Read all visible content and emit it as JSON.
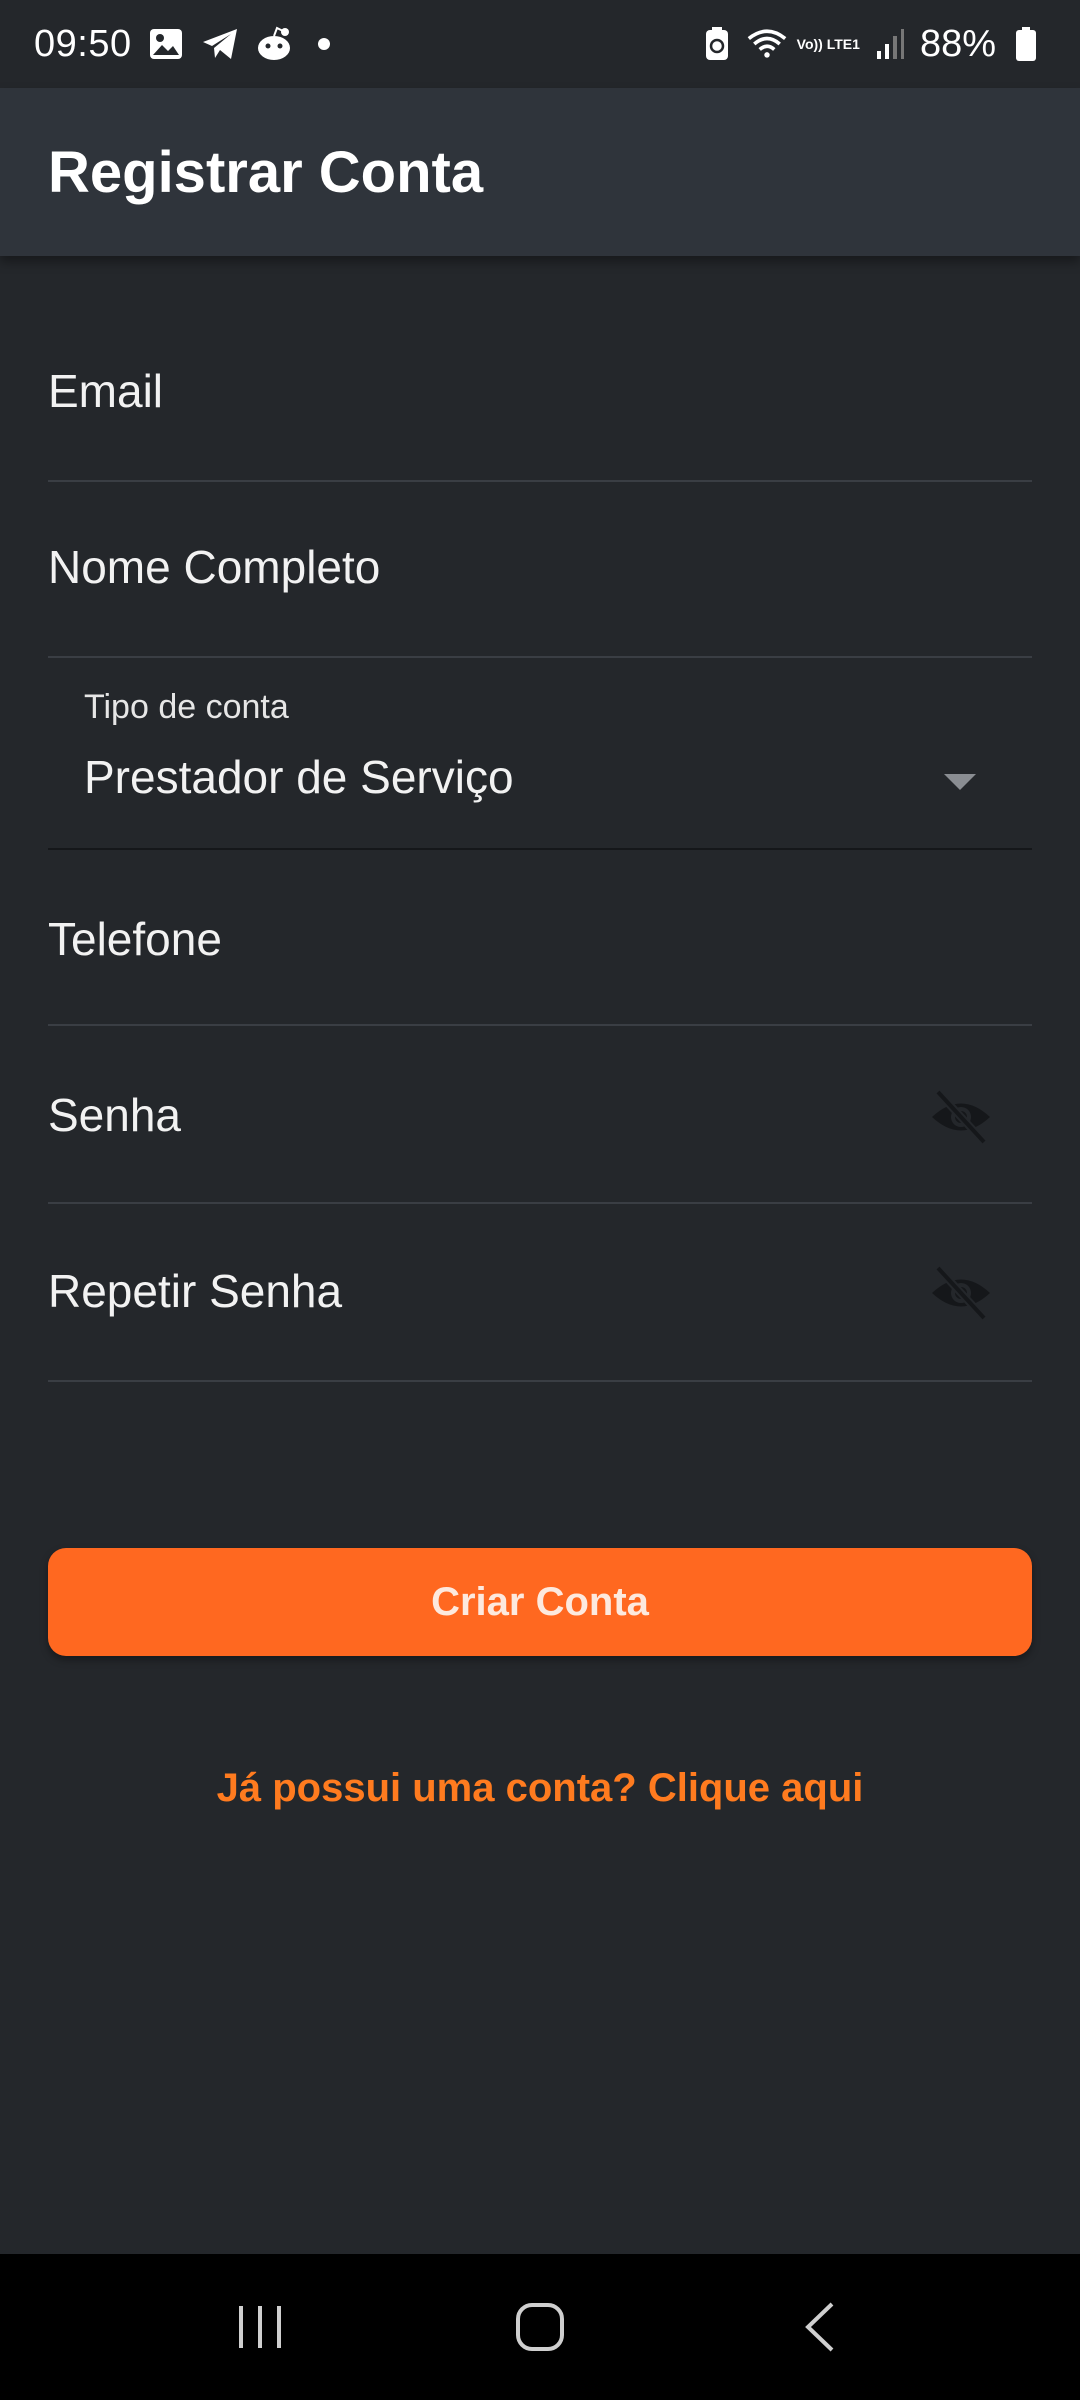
{
  "status_bar": {
    "time": "09:50",
    "battery_percent": "88%",
    "network_label": "Vo)) LTE1",
    "icons": [
      "gallery-icon",
      "telegram-icon",
      "reddit-icon",
      "notification-dot-icon",
      "battery-saver-icon",
      "wifi-icon",
      "volte-icon",
      "signal-icon",
      "battery-icon"
    ]
  },
  "app_bar": {
    "title": "Registrar Conta"
  },
  "form": {
    "email_label": "Email",
    "name_label": "Nome Completo",
    "account_type": {
      "label": "Tipo de conta",
      "selected": "Prestador de Serviço"
    },
    "phone_label": "Telefone",
    "password_label": "Senha",
    "repeat_password_label": "Repetir Senha"
  },
  "actions": {
    "create_account": "Criar Conta",
    "login_link": "Já possui uma conta? Clique aqui"
  },
  "colors": {
    "background": "#24272b",
    "app_bar": "#2f343b",
    "accent": "#ff6820",
    "link": "#ff7b1f"
  },
  "nav_bar": {
    "icons": [
      "recent-apps-icon",
      "home-icon",
      "back-icon"
    ]
  }
}
